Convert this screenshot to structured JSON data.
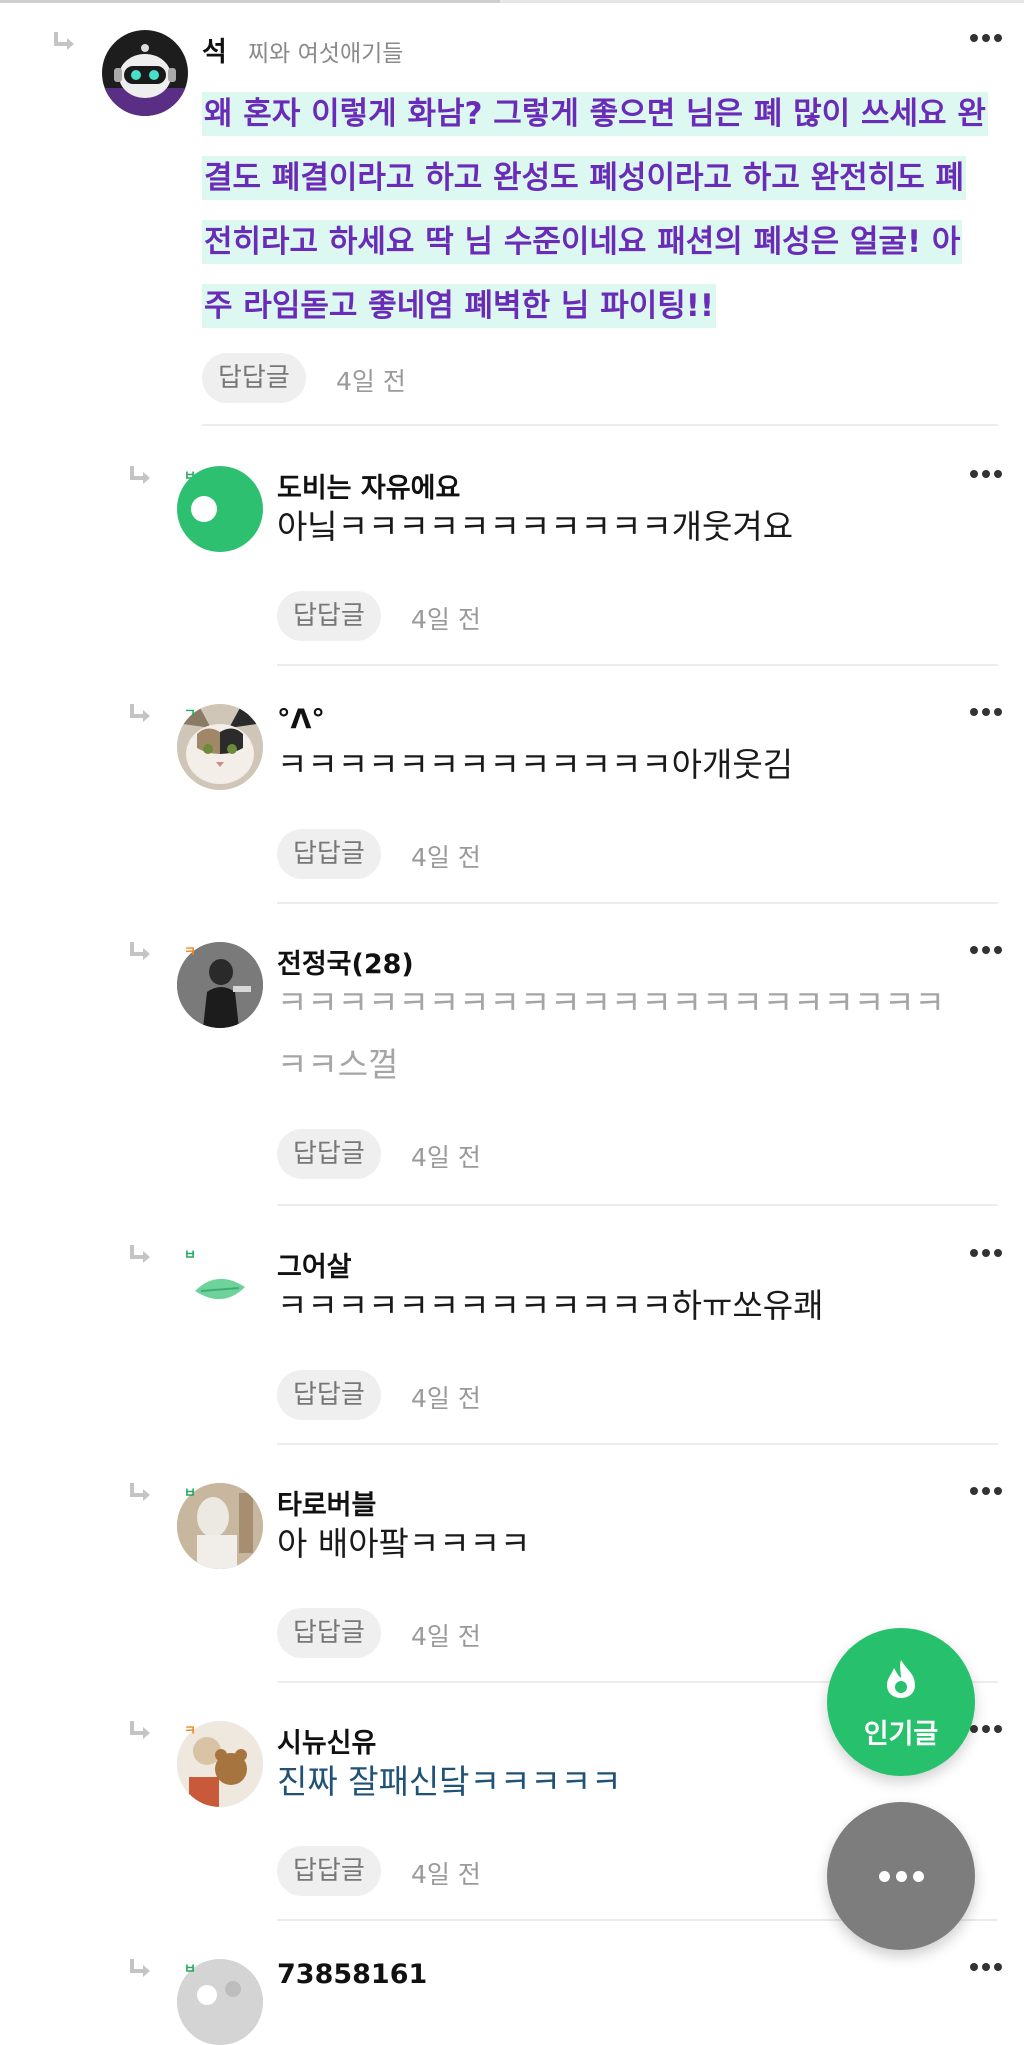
{
  "colors": {
    "accent_green": "#27c16d",
    "highlight_bg": "#dcf8f1",
    "highlight_text": "#6a2bb8",
    "blue_text": "#1f5277"
  },
  "icons": {
    "reply_arrow": "reply-arrow-icon",
    "more": "more-dots-icon",
    "fire": "fire-icon"
  },
  "comments": [
    {
      "name": "석",
      "sub": "찌와 여섯애기들",
      "lines": [
        "왜 혼자 이렇게 화남? 그렇게 좋으면 님은 폐 많이 쓰세요 완",
        "결도 폐결이라고 하고 완성도 폐성이라고 하고 완전히도 폐",
        "전히라고 하세요 딱 님 수준이네요 패션의 폐성은 얼굴! 아",
        "주 라임돋고 좋네염 폐벽한 님 파이팅!!"
      ],
      "reply_label": "답답글",
      "time": "4일 전"
    },
    {
      "name": "도비는 자유에요",
      "level": "ㅂ",
      "lines": [
        "아닠ㅋㅋㅋㅋㅋㅋㅋㅋㅋㅋㅋ개웃겨요"
      ],
      "reply_label": "답답글",
      "time": "4일 전"
    },
    {
      "name": "°ᐱ°",
      "level": "ㄱ",
      "lines": [
        "ㅋㅋㅋㅋㅋㅋㅋㅋㅋㅋㅋㅋㅋ아개웃김"
      ],
      "reply_label": "답답글",
      "time": "4일 전"
    },
    {
      "name": "전정국(28)",
      "level": "ㅋ",
      "lines": [
        "ㅋㅋㅋㅋㅋㅋㅋㅋㅋㅋㅋㅋㅋㅋㅋㅋㅋㅋㅋㅋㅋㅋ",
        "ㅋㅋ스껄"
      ],
      "reply_label": "답답글",
      "time": "4일 전"
    },
    {
      "name": "그어살",
      "level": "ㅂ",
      "lines": [
        "ㅋㅋㅋㅋㅋㅋㅋㅋㅋㅋㅋㅋㅋ하ㅠ쏘유쾌"
      ],
      "reply_label": "답답글",
      "time": "4일 전"
    },
    {
      "name": "타로버블",
      "level": "ㅂ",
      "lines": [
        "아 배아팤ㅋㅋㅋㅋ"
      ],
      "reply_label": "답답글",
      "time": "4일 전"
    },
    {
      "name": "시뉴신유",
      "level": "ㅋ",
      "lines": [
        "진짜 잘패신닼ㅋㅋㅋㅋㅋ"
      ],
      "reply_label": "답답글",
      "time": "4일 전"
    },
    {
      "name": "73858161",
      "level": "ㅂ"
    }
  ],
  "fab": {
    "popular_label": "인기글"
  }
}
